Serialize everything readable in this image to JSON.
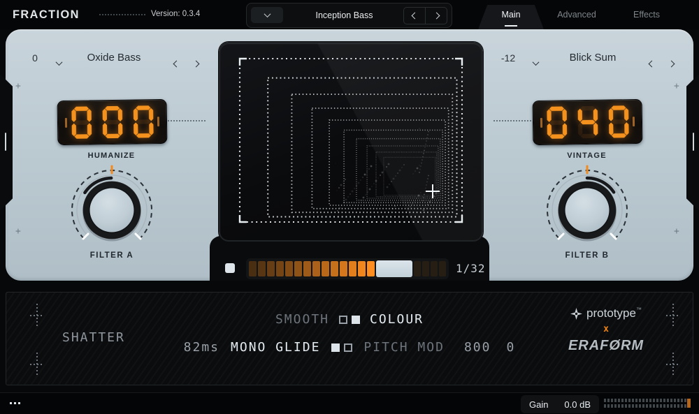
{
  "colors": {
    "accent_orange": "#f28a1e",
    "led_orange": "#f5921e",
    "panel_light": "#bccad2",
    "step_ramp_start": "#4a2e12",
    "step_ramp_end": "#ff8d1f",
    "step_dim": "#271e13"
  },
  "header": {
    "logo": "FRACTION",
    "version": "Version: 0.3.4",
    "preset_name": "Inception Bass",
    "tabs": [
      "Main",
      "Advanced",
      "Effects"
    ],
    "active_tab": "Main"
  },
  "main_panel": {
    "left_selector": {
      "value": "0",
      "name": "Oxide Bass"
    },
    "right_selector": {
      "value": "-12",
      "name": "Blick Sum"
    },
    "displays": {
      "left": {
        "value": "000",
        "label": "HUMANIZE"
      },
      "right": {
        "value": "040",
        "label": "VINTAGE"
      }
    },
    "knobs": {
      "left": {
        "label": "FILTER A",
        "trail": "left"
      },
      "right": {
        "label": "FILTER B",
        "trail": "right"
      }
    },
    "step_bar": {
      "lit_steps": 14,
      "dim_steps": 4,
      "rate": "1/32"
    }
  },
  "lower_panel": {
    "shatter": "SHATTER",
    "smooth": "SMOOTH",
    "colour": "COLOUR",
    "glide_time": "82ms",
    "mono_glide": "MONO GLIDE",
    "pitch_mod": "PITCH MOD",
    "pitch_values": [
      "800",
      "0"
    ],
    "brand": {
      "prototype": "prototype",
      "tm": "™",
      "x": "x",
      "eraform": "ERAFØRM"
    }
  },
  "footer": {
    "gain_label": "Gain",
    "gain_value": "0.0 dB"
  }
}
